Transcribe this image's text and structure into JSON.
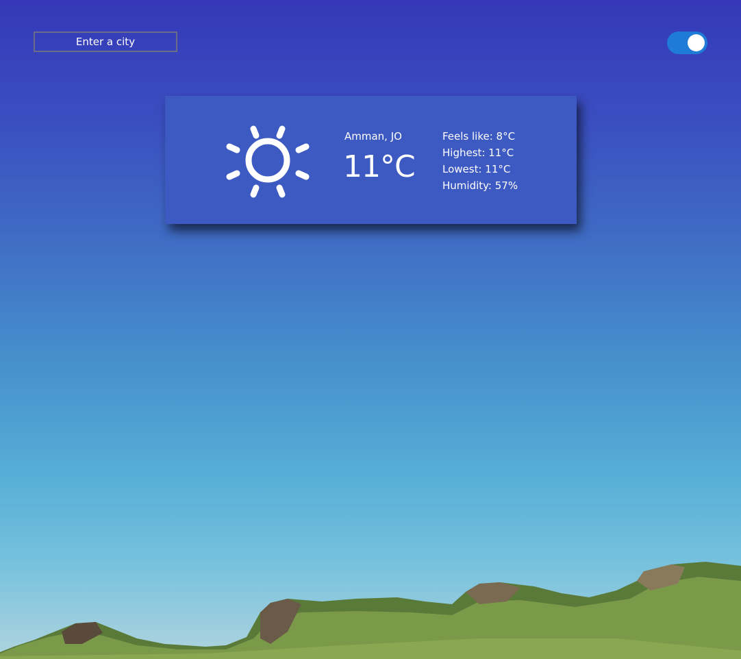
{
  "search": {
    "placeholder": "Enter a city"
  },
  "theme_toggle": {
    "state": "on",
    "color": "#1f7bd6"
  },
  "weather": {
    "icon": "sun-icon",
    "location": "Amman, JO",
    "temperature": "11°C",
    "feels_like": "Feels like: 8°C",
    "highest": "Highest: 11°C",
    "lowest": "Lowest: 11°C",
    "humidity": "Humidity: 57%"
  },
  "colors": {
    "card": "#3d59c2",
    "sky_top": "#3538b8",
    "sky_bottom": "#b0d4de"
  }
}
